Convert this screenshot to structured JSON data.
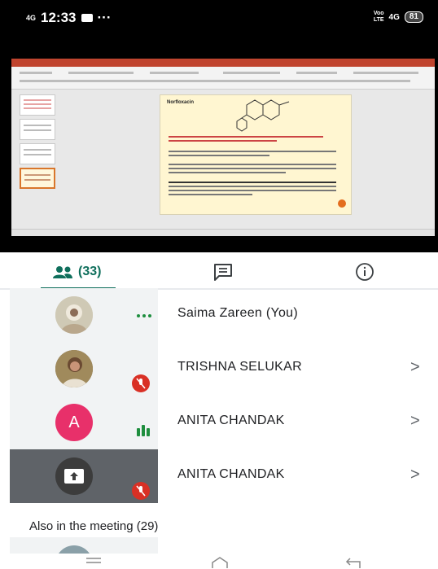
{
  "status": {
    "network_left": "4G",
    "time": "12:33",
    "more": "···",
    "network_right_top": "Voo",
    "network_right_bottom": "LTE",
    "network_right_gen": "4G",
    "battery": "81"
  },
  "slide": {
    "heading": "Norfloxacin"
  },
  "tabs": {
    "people_count": "(33)"
  },
  "participants": [
    {
      "name": "Saima Zareen (You)",
      "status": "speaking-dots"
    },
    {
      "name": "TRISHNA SELUKAR",
      "status": "muted"
    },
    {
      "name": "ANITA CHANDAK",
      "initial": "A",
      "status": "audio-bars"
    },
    {
      "name": "ANITA CHANDAK",
      "status": "muted-presenting"
    }
  ],
  "chevron": ">",
  "also_in_meeting": "Also in the meeting (29)",
  "colors": {
    "accent": "#0f6f5c",
    "muted_red": "#d93025",
    "avatar_pink": "#e8306a",
    "speaking_green": "#1e8e3e"
  }
}
